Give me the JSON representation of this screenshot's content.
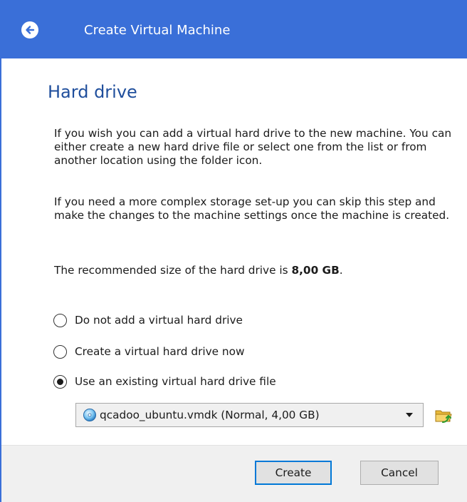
{
  "window": {
    "title": "Create Virtual Machine"
  },
  "page": {
    "title": "Hard drive",
    "paragraph1": "If you wish you can add a virtual hard drive to the new machine. You can either create a new hard drive file or select one from the list or from another location using the folder icon.",
    "paragraph2": "If you need a more complex storage set-up you can skip this step and make the changes to the machine settings once the machine is created.",
    "recommended_prefix": "The recommended size of the hard drive is ",
    "recommended_size": "8,00 GB",
    "recommended_suffix": "."
  },
  "options": [
    {
      "label": "Do not add a virtual hard drive",
      "selected": false
    },
    {
      "label": "Create a virtual hard drive now",
      "selected": false
    },
    {
      "label": "Use an existing virtual hard drive file",
      "selected": true
    }
  ],
  "disk_select": {
    "value": "qcadoo_ubuntu.vmdk (Normal, 4,00 GB)",
    "icon": "disk-icon"
  },
  "buttons": {
    "create": "Create",
    "cancel": "Cancel"
  },
  "colors": {
    "titlebar": "#3a6fd8",
    "page_title": "#1f4e9c",
    "focus_border": "#0078d7"
  },
  "icons": {
    "back": "back-arrow-icon",
    "folder": "folder-icon",
    "dropdown": "chevron-down-icon"
  }
}
